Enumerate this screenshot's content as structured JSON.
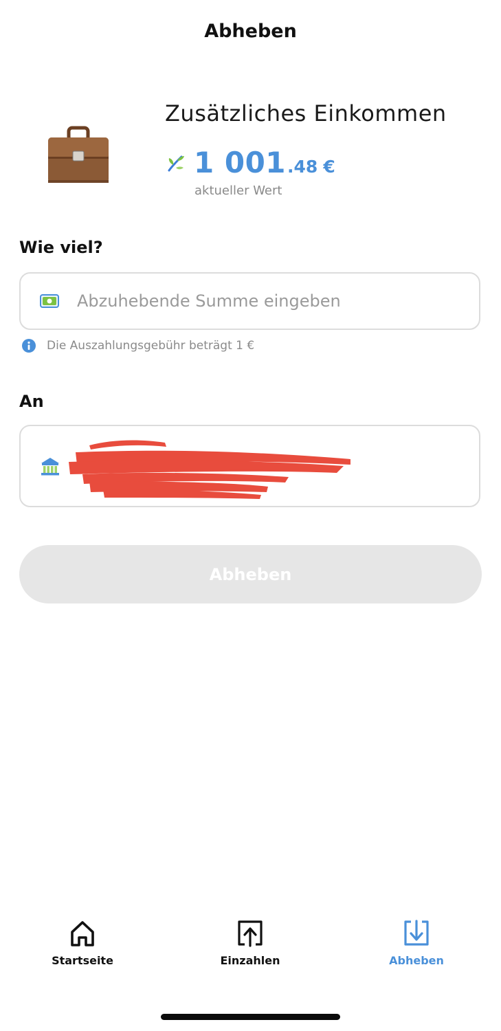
{
  "header": {
    "title": "Abheben"
  },
  "goal": {
    "name": "Zusätzliches Einkommen",
    "icon": "briefcase-icon",
    "value_main": "1 001",
    "value_decimals": ".48",
    "currency": "€",
    "value_caption": "aktueller Wert"
  },
  "amount_section": {
    "label": "Wie viel?",
    "placeholder": "Abzuhebende Summe eingeben",
    "value": "",
    "fee_note": "Die Auszahlungsgebühr beträgt 1 €"
  },
  "account_section": {
    "label": "An"
  },
  "actions": {
    "withdraw_label": "Abheben"
  },
  "bottom_nav": {
    "items": [
      {
        "label": "Startseite",
        "icon": "home-icon",
        "active": false
      },
      {
        "label": "Einzahlen",
        "icon": "deposit-icon",
        "active": false
      },
      {
        "label": "Abheben",
        "icon": "withdraw-icon",
        "active": true
      }
    ]
  },
  "colors": {
    "accent": "#4a90d9",
    "disabled_button": "#e6e6e6",
    "redaction": "#e84c3d",
    "border": "#dcdcdc"
  }
}
